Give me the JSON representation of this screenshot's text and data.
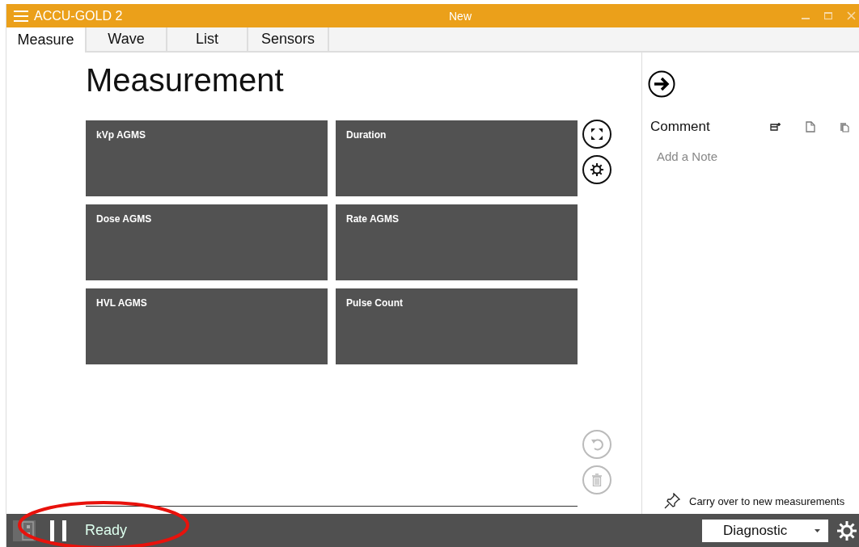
{
  "window": {
    "app_name": "ACCU-GOLD 2",
    "title": "New"
  },
  "tabs": [
    {
      "label": "Measure",
      "selected": true
    },
    {
      "label": "Wave",
      "selected": false
    },
    {
      "label": "List",
      "selected": false
    },
    {
      "label": "Sensors",
      "selected": false
    }
  ],
  "heading": "Measurement",
  "tiles": [
    {
      "label": "kVp AGMS"
    },
    {
      "label": "Duration"
    },
    {
      "label": "Dose AGMS"
    },
    {
      "label": "Rate AGMS"
    },
    {
      "label": "HVL AGMS"
    },
    {
      "label": "Pulse Count"
    }
  ],
  "side_actions": [
    {
      "kind": "expand",
      "disabled": false
    },
    {
      "kind": "settings",
      "disabled": false
    },
    {
      "kind": "undo",
      "disabled": true
    },
    {
      "kind": "delete",
      "disabled": true
    }
  ],
  "comment_panel": {
    "title": "Comment",
    "placeholder": "Add a Note",
    "carry_over": "Carry over to new measurements"
  },
  "status_bar": {
    "status": "Ready",
    "mode": "Diagnostic"
  }
}
